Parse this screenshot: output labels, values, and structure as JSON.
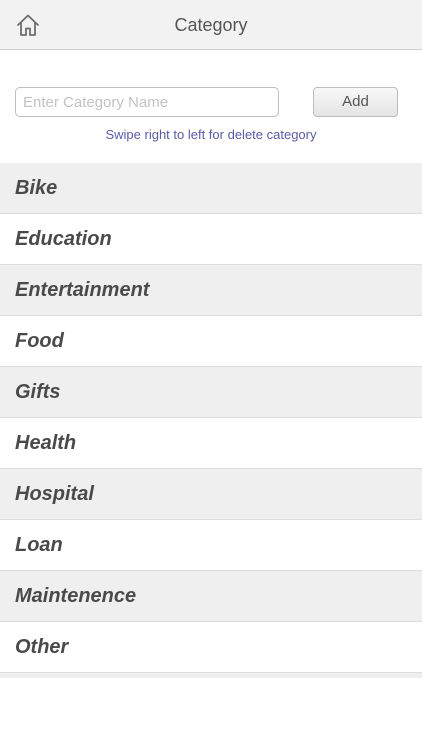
{
  "header": {
    "title": "Category",
    "home_icon": "home-icon"
  },
  "add_form": {
    "input_value": "",
    "input_placeholder": "Enter Category Name",
    "add_label": "Add",
    "hint": "Swipe right to left for delete category"
  },
  "categories": [
    {
      "label": "Bike"
    },
    {
      "label": "Education"
    },
    {
      "label": "Entertainment"
    },
    {
      "label": "Food"
    },
    {
      "label": "Gifts"
    },
    {
      "label": "Health"
    },
    {
      "label": "Hospital"
    },
    {
      "label": "Loan"
    },
    {
      "label": "Maintenence"
    },
    {
      "label": "Other"
    }
  ],
  "colors": {
    "nav_background": "#f2f2f2",
    "row_alt_background": "#efefef",
    "hint_text": "#5a5aa8",
    "category_text": "#4a4a4a"
  }
}
